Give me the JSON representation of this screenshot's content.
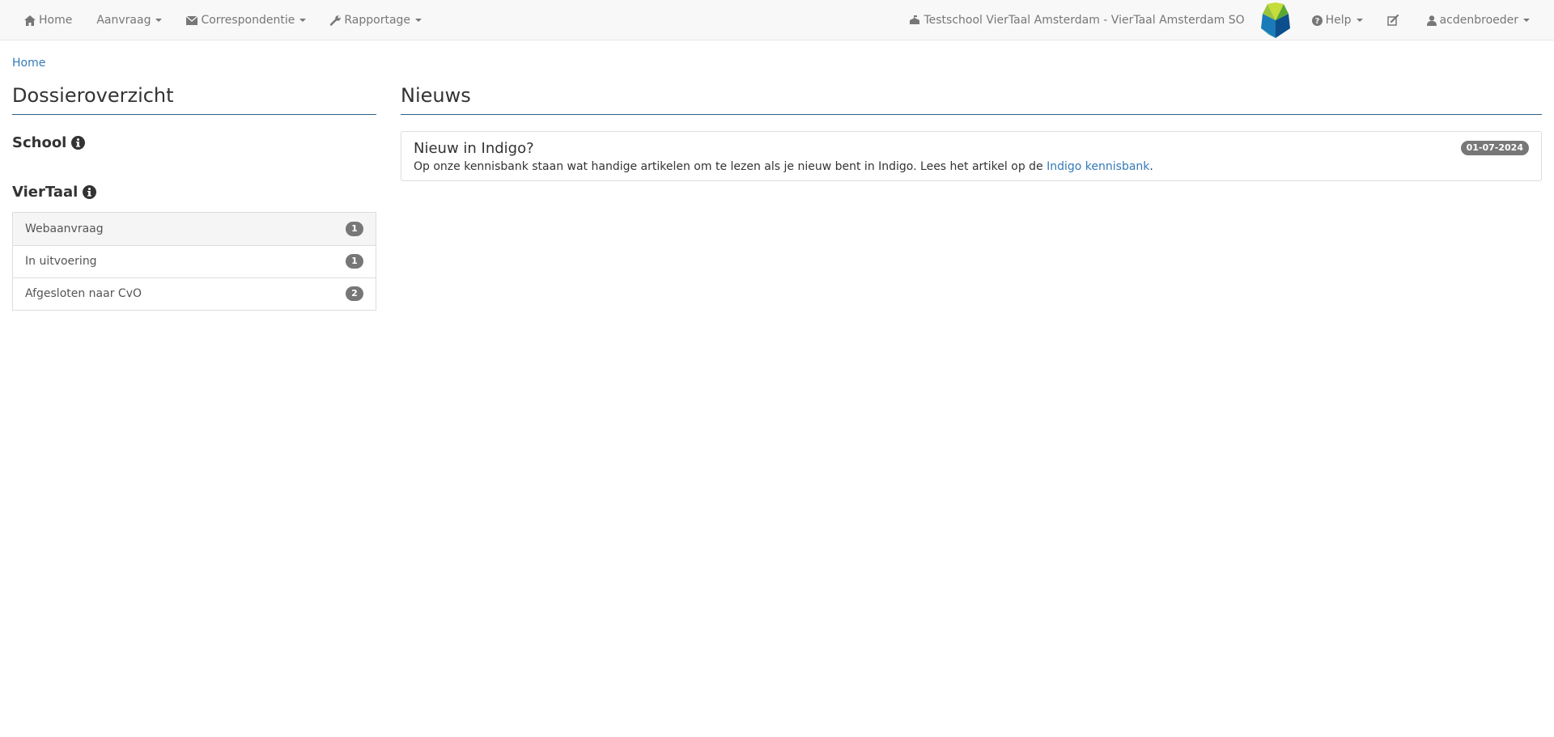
{
  "nav": {
    "home": "Home",
    "aanvraag": "Aanvraag",
    "correspondentie": "Correspondentie",
    "rapportage": "Rapportage",
    "school": "Testschool VierTaal Amsterdam - VierTaal Amsterdam SO",
    "help": "Help",
    "user": "acdenbroeder"
  },
  "breadcrumb": {
    "home": "Home"
  },
  "dossier": {
    "title": "Dossieroverzicht",
    "school_label": "School",
    "viertaal_label": "VierTaal",
    "items": [
      {
        "label": "Webaanvraag",
        "count": "1"
      },
      {
        "label": "In uitvoering",
        "count": "1"
      },
      {
        "label": "Afgesloten naar CvO",
        "count": "2"
      }
    ]
  },
  "news": {
    "title": "Nieuws",
    "items": [
      {
        "title": "Nieuw in Indigo?",
        "date": "01-07-2024",
        "text": "Op onze kennisbank staan wat handige artikelen om te lezen als je nieuw bent in Indigo. Lees het artikel op de ",
        "link": "Indigo kennisbank",
        "suffix": "."
      }
    ]
  },
  "icons": {
    "home": "home-icon",
    "envelope": "envelope-icon",
    "wrench": "wrench-icon",
    "school": "school-icon",
    "question": "question-circle-icon",
    "edit": "edit-icon",
    "user": "user-icon",
    "info": "info-circle-icon"
  },
  "colors": {
    "navbar_bg": "#f8f8f8",
    "link": "#337ab7",
    "badge": "#777777",
    "heading_rule": "#2e5f8a"
  }
}
